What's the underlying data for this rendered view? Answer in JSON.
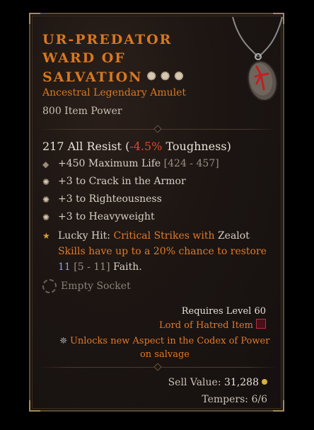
{
  "item": {
    "name_line1": "UR-PREDATOR",
    "name_line2": "WARD OF",
    "name_line3": "SALVATION",
    "stars": "✺✺✺",
    "rarity": "Ancestral Legendary Amulet",
    "item_power": "800 Item Power",
    "icon": "amulet-icon"
  },
  "resist": {
    "value": "217 All Resist",
    "open_paren": " (",
    "pct": "-4.5%",
    "suffix": " Toughness)"
  },
  "affixes": [
    {
      "value": "+450",
      "label": " Maximum Life ",
      "range": "[424 - 457]",
      "icon": "diamond-icon"
    },
    {
      "text": "+3 to Crack in the Armor",
      "icon": "star-burst-icon"
    },
    {
      "text": "+3 to Righteousness",
      "icon": "star-burst-icon"
    },
    {
      "text": "+3 to Heavyweight",
      "icon": "star-burst-icon"
    }
  ],
  "lucky": {
    "prefix": "Lucky Hit: ",
    "p1": "Critical Strikes with ",
    "skill": "Zealot",
    "p2": "Skills have up to a 20% chance to restore",
    "amount": "11",
    "range": " [5 - 11]",
    "resource": " Faith."
  },
  "socket": {
    "label": "Empty Socket"
  },
  "requirements": {
    "level": "Requires Level 60",
    "source": "Lord of Hatred Item"
  },
  "unlock": {
    "text": "Unlocks new Aspect in the Codex of Power on salvage"
  },
  "footer": {
    "sell_label": "Sell Value: ",
    "sell_value": "31,288",
    "tempers": "Tempers: 6/6"
  },
  "colors": {
    "legendary": "#d87820",
    "negative": "#e0462e",
    "numeric_blue": "#8c9cf0"
  }
}
